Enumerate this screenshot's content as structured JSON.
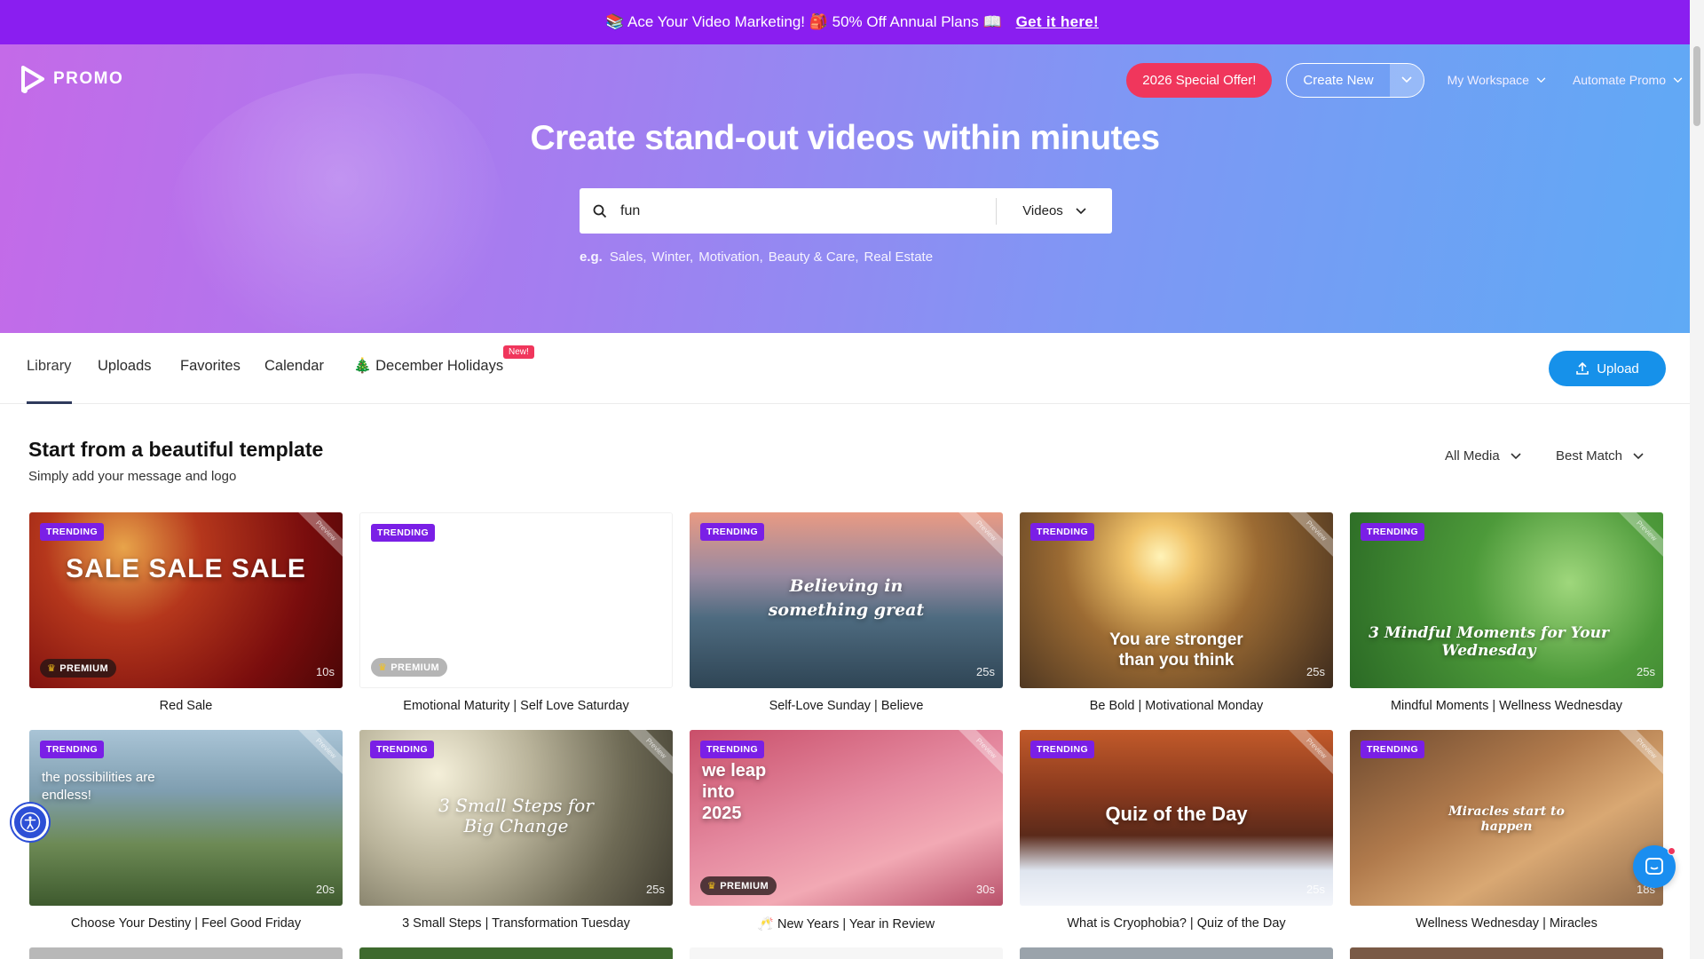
{
  "promo_bar": {
    "text": "📚 Ace Your Video Marketing! 🎒 50% Off Annual Plans 📖",
    "link": "Get it here!"
  },
  "header": {
    "logo_text": "PROMO",
    "special_offer": "2026 Special Offer!",
    "create_new": "Create New",
    "my_workspace": "My Workspace",
    "automate": "Automate Promo"
  },
  "hero": {
    "title": "Create stand-out videos within minutes",
    "search_value": "fun",
    "search_type": "Videos",
    "examples_label": "e.g.",
    "examples": [
      "Sales,",
      "Winter,",
      "Motivation,",
      "Beauty & Care,",
      "Real Estate"
    ]
  },
  "tabs": {
    "library": "Library",
    "uploads": "Uploads",
    "favorites": "Favorites",
    "calendar": "Calendar",
    "holidays": "🎄 December Holidays",
    "new_badge": "New!",
    "upload_button": "Upload"
  },
  "section": {
    "title": "Start from a beautiful template",
    "subtitle": "Simply add your message and logo",
    "filter_media": "All Media",
    "filter_sort": "Best Match"
  },
  "labels": {
    "trending": "TRENDING",
    "premium": "PREMIUM",
    "preview": "Preview"
  },
  "cards": [
    {
      "title": "Red Sale",
      "duration": "10s",
      "overlay": "SALE SALE SALE"
    },
    {
      "title": "Emotional Maturity | Self Love Saturday",
      "duration": "",
      "overlay": ""
    },
    {
      "title": "Self-Love Sunday | Believe",
      "duration": "25s",
      "overlay": "Believing in something great"
    },
    {
      "title": "Be Bold | Motivational Monday",
      "duration": "25s",
      "overlay": "You are stronger than you think"
    },
    {
      "title": "Mindful Moments | Wellness Wednesday",
      "duration": "25s",
      "overlay": "3 Mindful Moments for Your Wednesday"
    },
    {
      "title": "Choose Your Destiny | Feel Good Friday",
      "duration": "20s",
      "overlay": "the possibilities are endless!"
    },
    {
      "title": "3 Small Steps | Transformation Tuesday",
      "duration": "25s",
      "overlay": "3 Small Steps for Big Change"
    },
    {
      "title": "🥂 New Years | Year in Review",
      "duration": "30s",
      "overlay": "we leap into 2025"
    },
    {
      "title": "What is Cryophobia? | Quiz of the Day",
      "duration": "25s",
      "overlay": "Quiz of the Day"
    },
    {
      "title": "Wellness Wednesday | Miracles",
      "duration": "18s",
      "overlay": "Miracles start to happen"
    }
  ]
}
